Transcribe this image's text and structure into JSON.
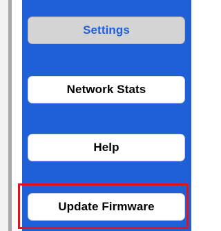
{
  "nav": {
    "items": [
      {
        "label": "Settings",
        "state": "selected"
      },
      {
        "label": "Network Stats",
        "state": "normal"
      },
      {
        "label": "Help",
        "state": "normal"
      },
      {
        "label": "Update Firmware",
        "state": "highlighted"
      }
    ]
  },
  "colors": {
    "panel_background": "#1f60d6",
    "selected_button_background": "#d4d4d4",
    "selected_button_text": "#1e60d8",
    "button_background": "#ffffff",
    "button_text": "#000000",
    "highlight_border": "#e3121c"
  }
}
